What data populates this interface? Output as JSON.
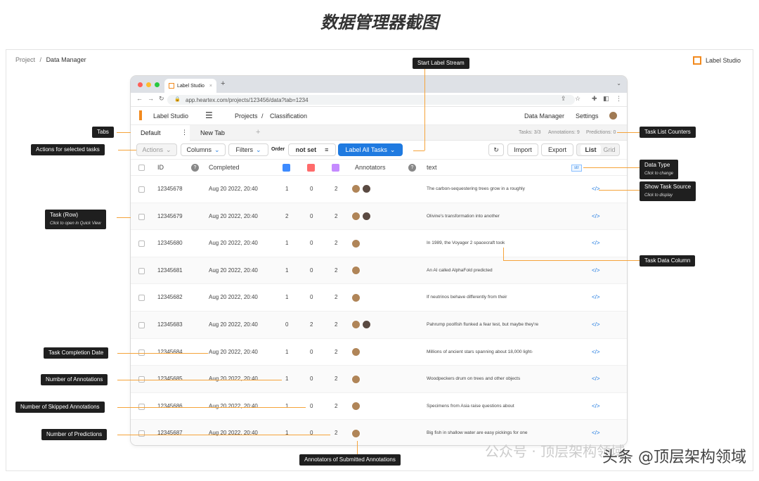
{
  "heading": "数据管理器截图",
  "breadcrumb": {
    "project": "Project",
    "sep": "/",
    "current": "Data Manager"
  },
  "brand": "Label Studio",
  "browser": {
    "tab_title": "Label Studio",
    "url": "app.heartex.com/projects/123456/data?tab=1234"
  },
  "app": {
    "logo": "Label Studio",
    "nav_projects": "Projects",
    "nav_sep": "/",
    "nav_project": "Classification",
    "data_manager": "Data Manager",
    "settings": "Settings"
  },
  "tabs": {
    "default": "Default",
    "new": "New Tab",
    "add": "+"
  },
  "counters": {
    "tasks": "Tasks: 3/3",
    "annotations": "Annotations: 9",
    "predictions": "Predictions: 0"
  },
  "toolbar": {
    "actions": "Actions",
    "columns": "Columns",
    "filters": "Filters",
    "order_label": "Order",
    "order_value": "not set",
    "label_all": "Label All Tasks",
    "import": "Import",
    "export": "Export",
    "list": "List",
    "grid": "Grid"
  },
  "columns": {
    "id": "ID",
    "completed": "Completed",
    "annotators": "Annotators",
    "text": "text",
    "type_badge": "str"
  },
  "rows": [
    {
      "id": "12345678",
      "completed": "Aug 20 2022, 20:40",
      "ann": "1",
      "skip": "0",
      "pred": "2",
      "text": "The carbon-sequestering trees grow in a roughly",
      "avatars": 2
    },
    {
      "id": "12345679",
      "completed": "Aug 20 2022, 20:40",
      "ann": "2",
      "skip": "0",
      "pred": "2",
      "text": "Olivine's transformation into another",
      "avatars": 2
    },
    {
      "id": "12345680",
      "completed": "Aug 20 2022, 20:40",
      "ann": "1",
      "skip": "0",
      "pred": "2",
      "text": "In 1989, the Voyager 2 spacecraft took",
      "avatars": 1
    },
    {
      "id": "12345681",
      "completed": "Aug 20 2022, 20:40",
      "ann": "1",
      "skip": "0",
      "pred": "2",
      "text": "An AI called AlphaFold predicted",
      "avatars": 1
    },
    {
      "id": "12345682",
      "completed": "Aug 20 2022, 20:40",
      "ann": "1",
      "skip": "0",
      "pred": "2",
      "text": "If neutrinos behave differently from their",
      "avatars": 1
    },
    {
      "id": "12345683",
      "completed": "Aug 20 2022, 20:40",
      "ann": "0",
      "skip": "2",
      "pred": "2",
      "text": "Pahrump poolfish flunked a fear test, but maybe they're",
      "avatars": 2
    },
    {
      "id": "12345684",
      "completed": "Aug 20 2022, 20:40",
      "ann": "1",
      "skip": "0",
      "pred": "2",
      "text": "Millions of ancient stars spanning about 18,000 light-",
      "avatars": 1
    },
    {
      "id": "12345685",
      "completed": "Aug 20 2022, 20:40",
      "ann": "1",
      "skip": "0",
      "pred": "2",
      "text": "Woodpeckers drum on trees and other objects",
      "avatars": 1
    },
    {
      "id": "12345686",
      "completed": "Aug 20 2022, 20:40",
      "ann": "1",
      "skip": "0",
      "pred": "2",
      "text": "Specimens from Asia raise questions about",
      "avatars": 1
    },
    {
      "id": "12345687",
      "completed": "Aug 20 2022, 20:40",
      "ann": "1",
      "skip": "0",
      "pred": "2",
      "text": "Big fish in shallow water are easy pickings for one",
      "avatars": 1
    }
  ],
  "callouts": {
    "start_stream": "Start Label Stream",
    "tabs": "Tabs",
    "actions": "Actions for selected tasks",
    "counters": "Task List Counters",
    "data_type": "Data Type",
    "data_type_sub": "Click to change",
    "show_source": "Show Task Source",
    "show_source_sub": "Click to display",
    "task_row": "Task (Row)",
    "task_row_sub": "Click to open in Quick View",
    "data_column": "Task Data Column",
    "completion_date": "Task Completion Date",
    "num_annotations": "Number of Annotations",
    "num_skipped": "Number of Skipped Annotations",
    "num_predictions": "Number of Predictions",
    "annotators": "Annotators of Submitted Annotations"
  },
  "watermark": "头条 @顶层架构领域",
  "watermark2": "公众号 · 顶层架构领域",
  "colors": {
    "accent": "#1f7ae0",
    "brand": "#f28a1e",
    "callout_line": "#f5a33a"
  }
}
